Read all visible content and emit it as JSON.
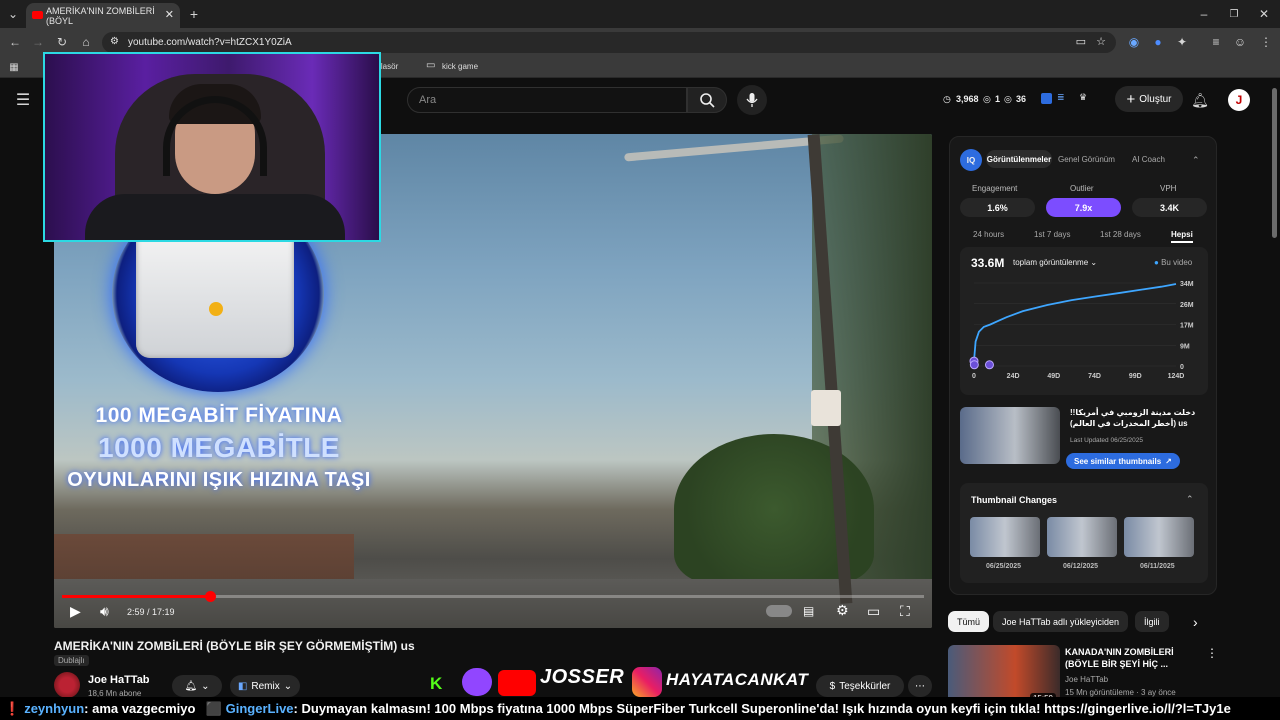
{
  "browser": {
    "tab_title": "AMERİKA'NIN ZOMBİLERİ (BÖYL",
    "url": "youtube.com/watch?v=htZCX1Y0ZiA",
    "bookmarks": [
      "eni klasör",
      "kick game"
    ]
  },
  "header": {
    "search_placeholder": "Ara",
    "stat_views": "3,968",
    "stat_a": "1",
    "stat_b": "36",
    "create_label": "Oluştur",
    "avatar_letter": "J"
  },
  "video": {
    "promo_line1": "100 MEGABİT FİYATINA",
    "promo_line2": "1000 MEGABİTLE",
    "promo_line3": "OYUNLARINI IŞIK HIZINA TAŞI",
    "time": "2:59 / 17:19",
    "progress": 0.172,
    "title": "AMERİKA'NIN ZOMBİLERİ (BÖYLE BİR ŞEY GÖRMEMİŞTİM) us",
    "dubbed_label": "Dublajlı",
    "channel_name": "Joe HaTTab",
    "subscribers": "18,6 Mn abone",
    "remix_label": "Remix",
    "thanks_label": "Teşekkürler",
    "sponsor_1": "JOSSER",
    "sponsor_2": "HAYATACANKAT"
  },
  "ticker": {
    "user1": "zeynhyun",
    "msg1": ": ama vazgecmiyo",
    "user2": "GingerLive",
    "msg2": ": Duymayan kalmasın! 100 Mbps fiyatına 1000 Mbps SüperFiber Turkcell Superonline'da! Işık hızında oyun keyfi için tıkla! https://gingerlive.io/l/?l=TJy1e"
  },
  "vidiq": {
    "logo": "IQ",
    "tabs": [
      "Görüntülenmeler",
      "Genel Görünüm",
      "AI Coach"
    ],
    "metrics": [
      {
        "label": "Engagement",
        "value": "1.6%"
      },
      {
        "label": "Outlier",
        "value": "7.9x"
      },
      {
        "label": "VPH",
        "value": "3.4K"
      }
    ],
    "ranges": [
      "24 hours",
      "1st 7 days",
      "1st 28 days",
      "Hepsi"
    ],
    "total_views": "33.6M",
    "views_dropdown": "toplam görüntülenme",
    "legend": "Bu video",
    "related_title": "دخلت مدينة الزومبي في أمريكا!! (أخطر المخدرات في العالم) us",
    "last_updated": "Last Updated 06/25/2025",
    "similar_btn": "See similar thumbnails",
    "thumb_changes_title": "Thumbnail Changes",
    "thumb_dates": [
      "06/25/2025",
      "06/12/2025",
      "06/11/2025"
    ]
  },
  "chart_data": {
    "type": "line",
    "x_tick_labels": [
      "0",
      "24D",
      "49D",
      "74D",
      "99D",
      "124D"
    ],
    "y_tick_labels": [
      "0",
      "9M",
      "17M",
      "26M",
      "34M"
    ],
    "ylim": [
      0,
      34
    ],
    "xlim": [
      0,
      124
    ],
    "x": [
      0,
      1,
      3,
      6,
      10,
      15,
      20,
      30,
      45,
      60,
      75,
      90,
      105,
      115,
      124
    ],
    "y": [
      2,
      10,
      14,
      16,
      17,
      18.5,
      20,
      22.5,
      25,
      27,
      28.5,
      30,
      31.5,
      32.5,
      33.6
    ],
    "legend": "top-right"
  },
  "chips": [
    "Tümü",
    "Joe HaTTab adlı yükleyiciden",
    "İlgili"
  ],
  "recommendation": {
    "title": "KANADA'NIN ZOMBİLERİ (BÖYLE BİR ŞEYİ HİÇ ...",
    "channel": "Joe HaTTab",
    "meta": "15 Mn görüntüleme · 3 ay önce",
    "duration": "15:59"
  }
}
